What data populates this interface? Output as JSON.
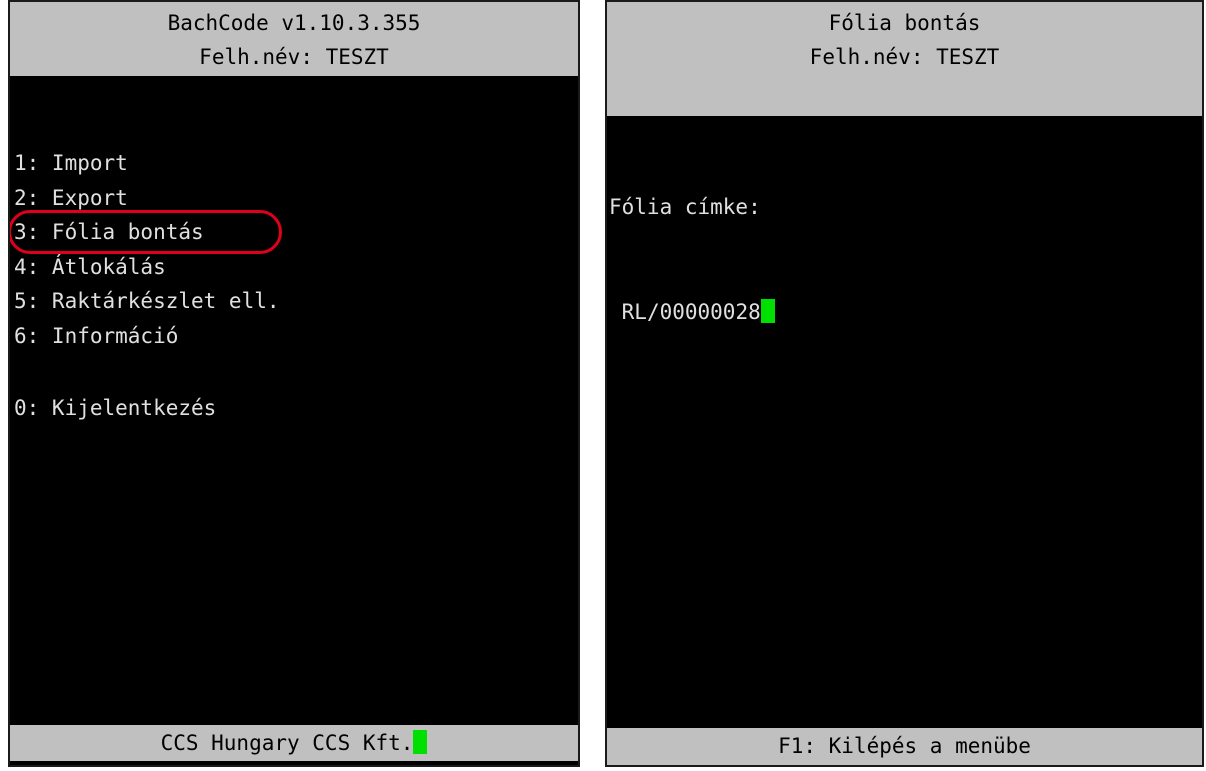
{
  "left_screen": {
    "header": {
      "title": "BachCode v1.10.3.355",
      "user": "Felh.név: TESZT"
    },
    "menu": [
      {
        "label": "1: Import"
      },
      {
        "label": "2: Export"
      },
      {
        "label": "3: Fólia bontás",
        "highlighted": true
      },
      {
        "label": "4: Átlokálás"
      },
      {
        "label": "5: Raktárkészlet ell."
      },
      {
        "label": "6: Információ"
      }
    ],
    "logout": "0: Kijelentkezés",
    "footer": "CCS Hungary CCS Kft."
  },
  "right_screen": {
    "header": {
      "title": "Fólia bontás",
      "user": "Felh.név: TESZT"
    },
    "field_label": "Fólia címke:",
    "field_value": "RL/00000028",
    "footer": "F1: Kilépés a menübe"
  },
  "colors": {
    "screen_bg": "#000000",
    "bar_bg": "#c0c0c0",
    "cursor": "#00e000",
    "highlight_ring": "#e0001b"
  }
}
